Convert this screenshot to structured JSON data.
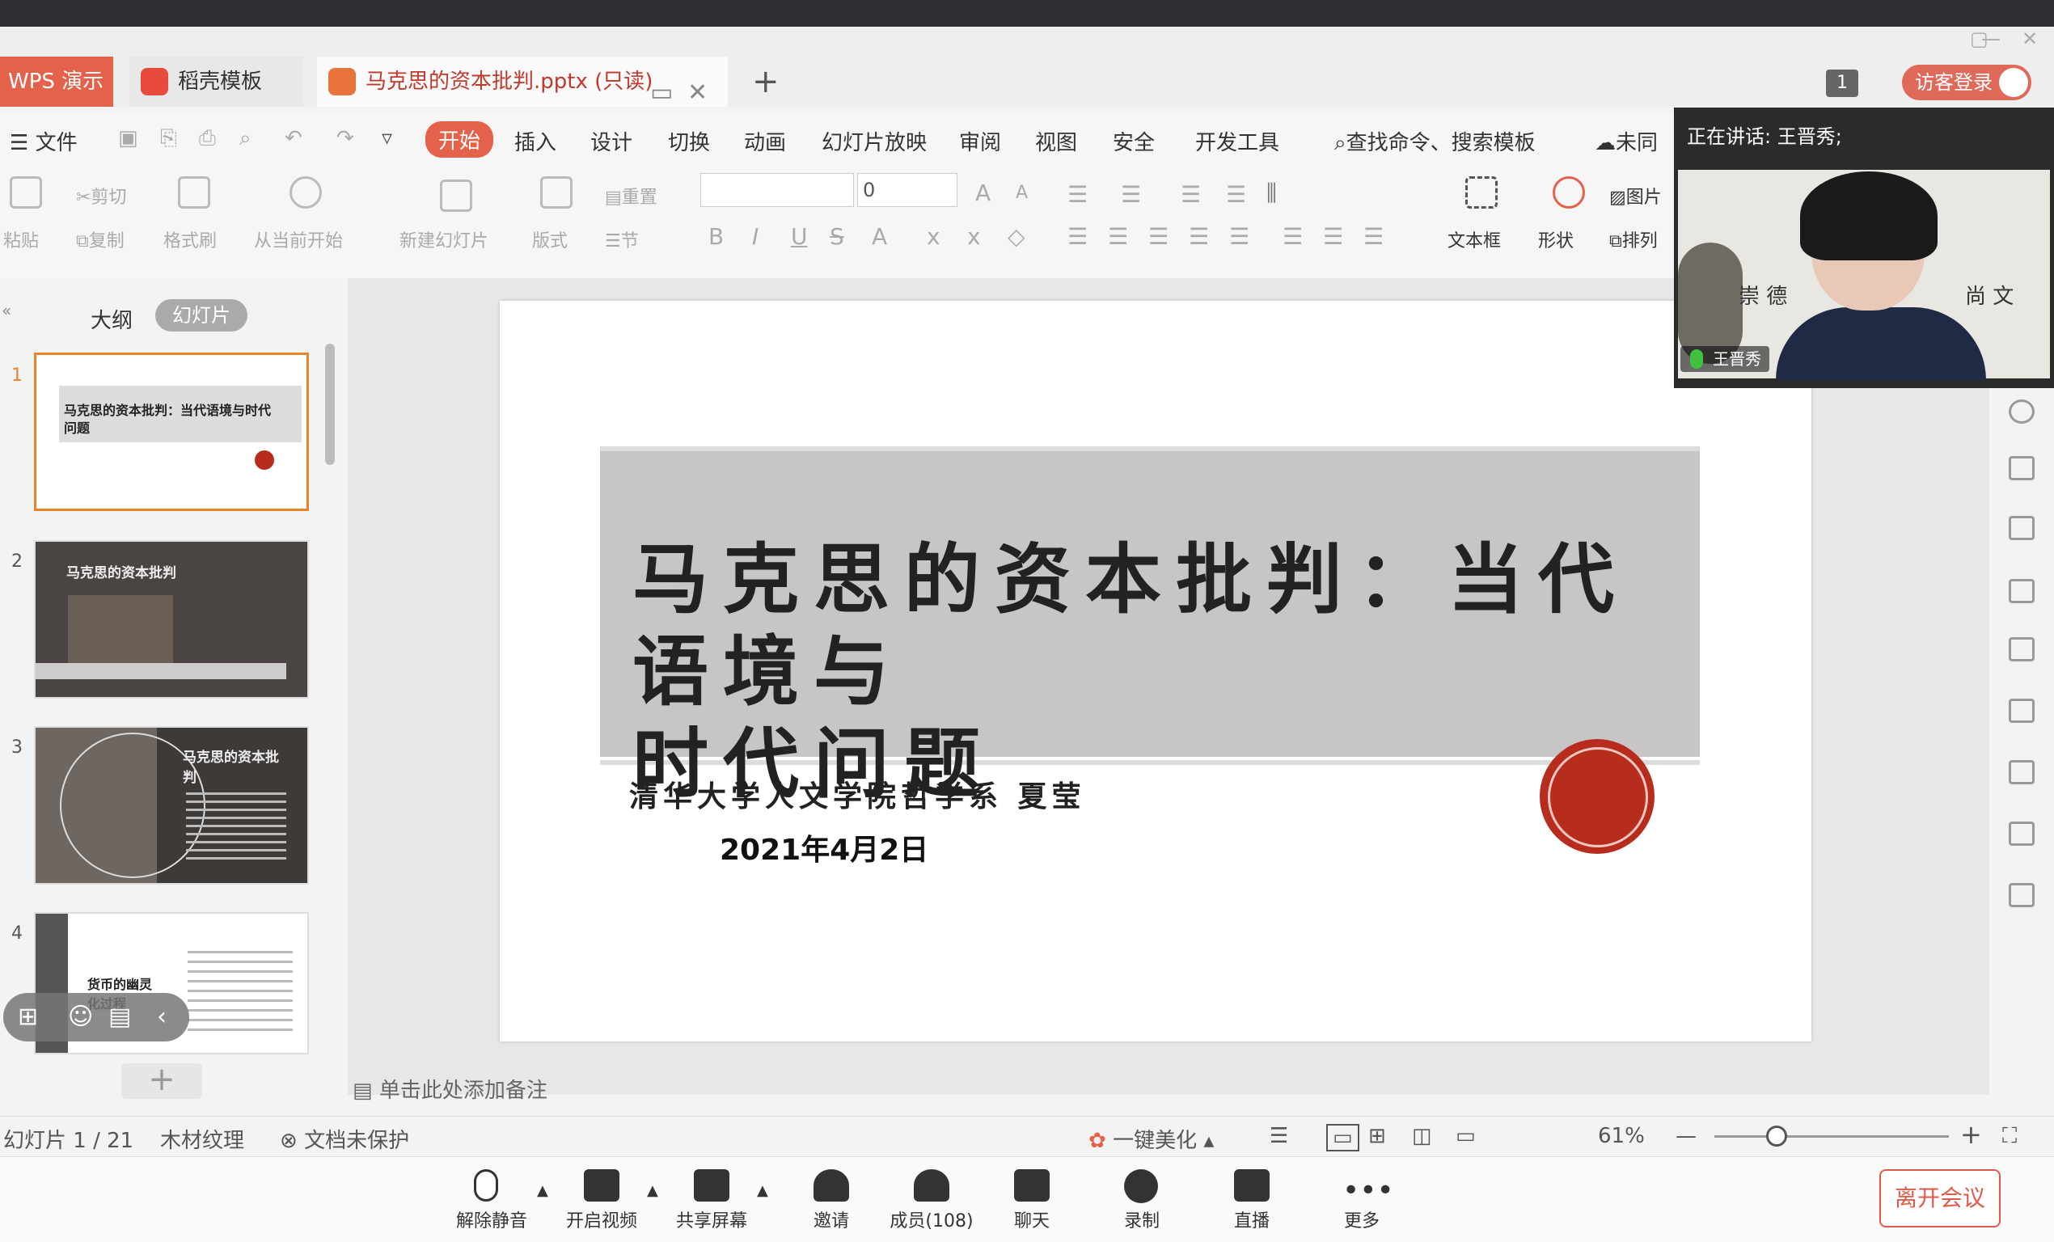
{
  "tabs": {
    "app": "WPS 演示",
    "templates": "稻壳模板",
    "document": "马克思的资本批判.pptx (只读)",
    "close": "✕",
    "new_tab": "+"
  },
  "header": {
    "badge": "1",
    "login": "访客登录"
  },
  "menu": {
    "file": "文件",
    "items": [
      "开始",
      "插入",
      "设计",
      "切换",
      "动画",
      "幻灯片放映",
      "审阅",
      "视图",
      "安全",
      "开发工具"
    ],
    "search": "查找命令、搜索模板",
    "sync": "未同"
  },
  "ribbon": {
    "paste": "粘贴",
    "cut": "剪切",
    "copy": "复制",
    "format_painter": "格式刷",
    "from_current": "从当前开始",
    "new_slide": "新建幻灯片",
    "layout": "版式",
    "reset": "重置",
    "section": "节",
    "font_size": "0",
    "textbox": "文本框",
    "shape": "形状",
    "picture": "图片",
    "arrange": "排列"
  },
  "panel": {
    "outline": "大纲",
    "slides": "幻灯片",
    "thumbs": [
      {
        "num": "1",
        "title": "马克思的资本批判：当代语境与时代问题"
      },
      {
        "num": "2",
        "title": "马克思的资本批判"
      },
      {
        "num": "3",
        "title": "马克思的资本批判"
      },
      {
        "num": "4",
        "title": "货币的幽灵化过程"
      }
    ]
  },
  "slide": {
    "title_line1": "马克思的资本批判：当代语境与",
    "title_line2": "时代问题",
    "subtitle": "清华大学人文学院哲学系 夏莹",
    "date": "2021年4月2日"
  },
  "notes_placeholder": "单击此处添加备注",
  "status": {
    "slide_counter": "幻灯片 1 / 21",
    "theme": "木材纹理",
    "protection": "文档未保护",
    "beautify": "一键美化",
    "zoom": "61%"
  },
  "video": {
    "speaking": "正在讲话: 王晋秀;",
    "participant": "王晋秀",
    "calligraphy_left": "崇 德",
    "calligraphy_right": "尚 文"
  },
  "meeting": {
    "mute": "解除静音",
    "video": "开启视频",
    "share": "共享屏幕",
    "invite": "邀请",
    "members": "成员(108)",
    "chat": "聊天",
    "record": "录制",
    "live": "直播",
    "more": "更多",
    "leave": "离开会议"
  },
  "colors": {
    "accent": "#e5624a",
    "leave": "#e05a4a",
    "seal": "#b82c1e"
  }
}
